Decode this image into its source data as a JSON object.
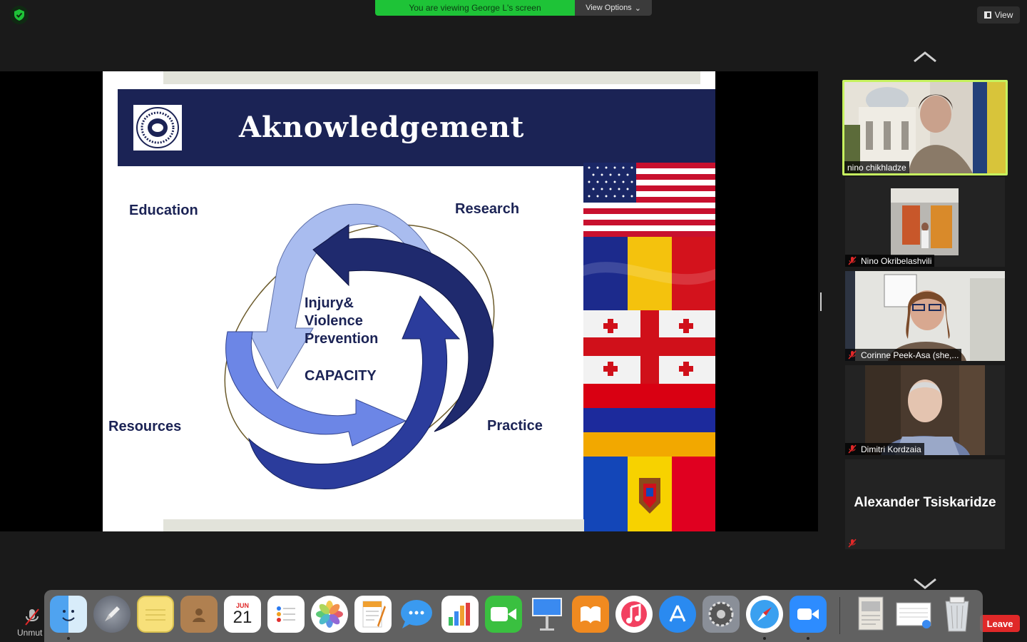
{
  "meeting": {
    "banner_text": "You are viewing George L's screen",
    "view_options_label": "View Options",
    "view_label": "View"
  },
  "slide": {
    "title": "Aknowledgement",
    "labels": {
      "education": "Education",
      "research": "Research",
      "resources": "Resources",
      "practice": "Practice"
    },
    "center_line1": "Injury&",
    "center_line2": "Violence",
    "center_line3": "Prevention",
    "center_capacity": "CAPACITY",
    "flags": [
      "usa-flag",
      "romania-flag",
      "georgia-flag",
      "armenia-flag",
      "moldova-flag"
    ]
  },
  "participants": [
    {
      "name": "nino chikhladze",
      "active": true,
      "muted": false,
      "video": true
    },
    {
      "name": "Nino Okribelashvili",
      "active": false,
      "muted": true,
      "video": true
    },
    {
      "name": "Corinne Peek-Asa (she,...",
      "active": false,
      "muted": true,
      "video": true
    },
    {
      "name": "Dimitri Kordzaia",
      "active": false,
      "muted": true,
      "video": true
    },
    {
      "name": "Alexander Tsiskaridze",
      "active": false,
      "muted": true,
      "video": false
    }
  ],
  "controls": {
    "unmute_label": "Unmut",
    "leave_label": "Leave"
  },
  "dock": {
    "calendar_month": "JUN",
    "calendar_day": "21",
    "apps": [
      "finder-icon",
      "launchpad-icon",
      "notes-icon",
      "contacts-icon",
      "calendar-icon",
      "reminders-icon",
      "photos-icon",
      "pages-icon",
      "messages-icon",
      "numbers-icon",
      "facetime-icon",
      "keynote-icon",
      "books-icon",
      "music-icon",
      "app-store-icon",
      "system-preferences-icon",
      "safari-icon",
      "zoom-icon",
      "document-icon",
      "screenshot-icon",
      "trash-icon"
    ]
  },
  "colors": {
    "accent_green": "#1ec337",
    "active_border": "#c6f25f",
    "slide_navy": "#1b2355",
    "leave_red": "#e02828"
  }
}
